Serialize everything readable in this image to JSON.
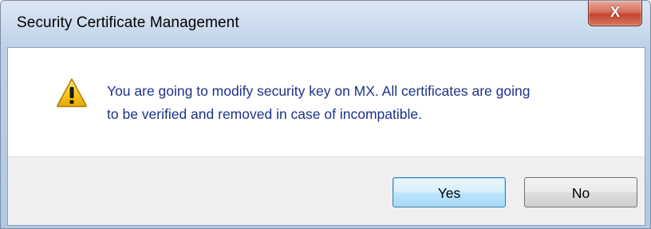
{
  "window": {
    "title": "Security Certificate Management",
    "close_icon": "close-icon",
    "close_glyph": "X"
  },
  "dialog": {
    "icon": "warning-icon",
    "message_line1": "You are going to modify security key on MX. All certificates are going",
    "message_line2": "to be verified and removed in case of incompatible."
  },
  "buttons": {
    "yes_label": "Yes",
    "no_label": "No"
  },
  "colors": {
    "message_text": "#1e3287",
    "close_button": "#c4452e",
    "warning_fill": "#f5c518",
    "default_button_border": "#3c7fb1"
  }
}
